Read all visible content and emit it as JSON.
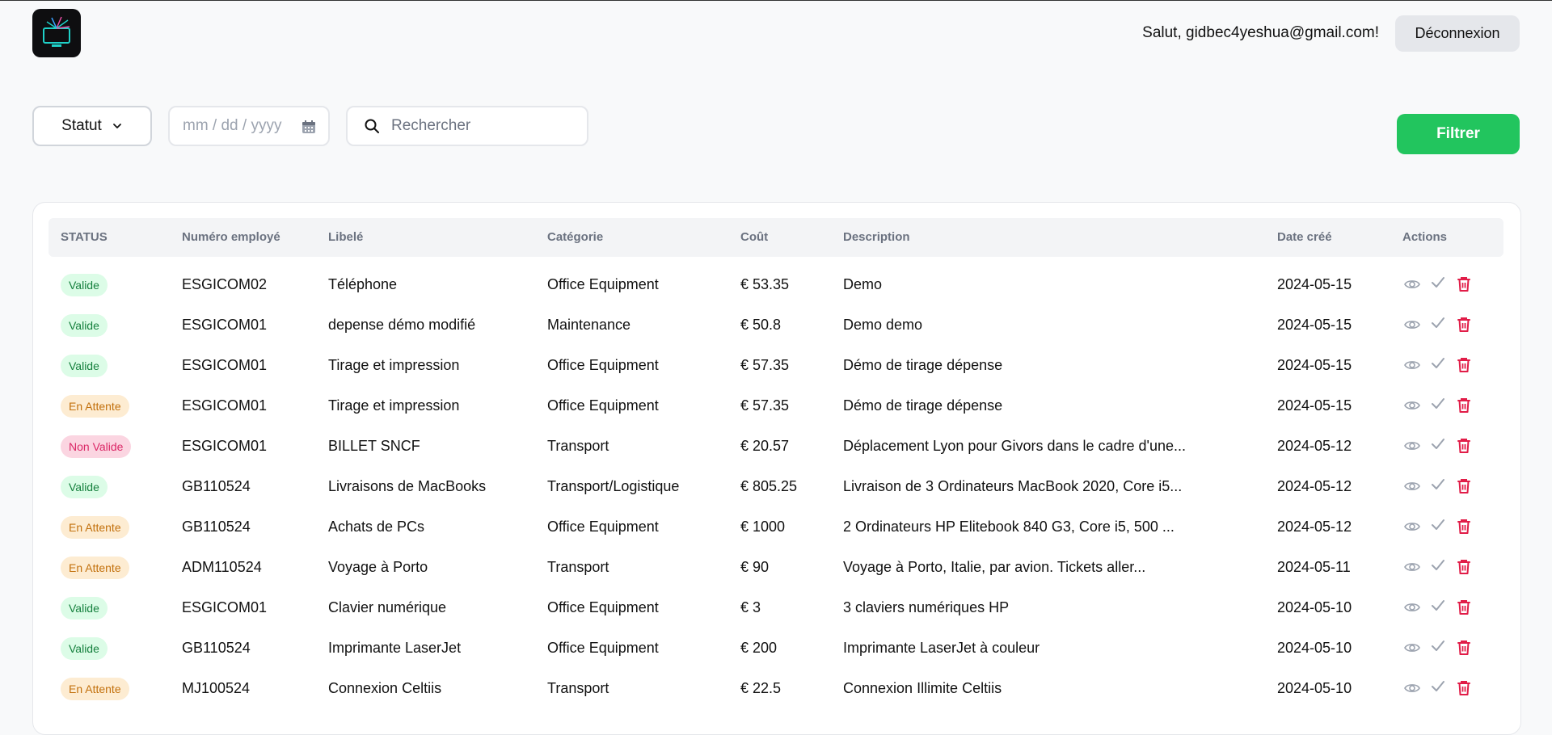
{
  "header": {
    "greeting": "Salut, gidbec4yeshua@gmail.com!",
    "logout_label": "Déconnexion"
  },
  "filters": {
    "status_label": "Statut",
    "date_placeholder": "mm / dd / yyyy",
    "search_placeholder": "Rechercher",
    "filter_label": "Filtrer"
  },
  "table": {
    "columns": [
      "STATUS",
      "Numéro employé",
      "Libelé",
      "Catégorie",
      "Coût",
      "Description",
      "Date créé",
      "Actions"
    ],
    "rows": [
      {
        "status": "Valide",
        "kind": "valide",
        "employee": "ESGICOM02",
        "label": "Téléphone",
        "category": "Office Equipment",
        "cost": "€ 53.35",
        "description": "Demo",
        "date": "2024-05-15"
      },
      {
        "status": "Valide",
        "kind": "valide",
        "employee": "ESGICOM01",
        "label": "depense démo modifié",
        "category": "Maintenance",
        "cost": "€ 50.8",
        "description": "Demo demo",
        "date": "2024-05-15"
      },
      {
        "status": "Valide",
        "kind": "valide",
        "employee": "ESGICOM01",
        "label": "Tirage et impression",
        "category": "Office Equipment",
        "cost": "€ 57.35",
        "description": "Démo de tirage dépense",
        "date": "2024-05-15"
      },
      {
        "status": "En Attente",
        "kind": "attente",
        "employee": "ESGICOM01",
        "label": "Tirage et impression",
        "category": "Office Equipment",
        "cost": "€ 57.35",
        "description": "Démo de tirage dépense",
        "date": "2024-05-15"
      },
      {
        "status": "Non Valide",
        "kind": "nonvalide",
        "employee": "ESGICOM01",
        "label": "BILLET SNCF",
        "category": "Transport",
        "cost": "€ 20.57",
        "description": "Déplacement Lyon pour Givors dans le cadre d'une...",
        "date": "2024-05-12"
      },
      {
        "status": "Valide",
        "kind": "valide",
        "employee": "GB110524",
        "label": "Livraisons de MacBooks",
        "category": "Transport/Logistique",
        "cost": "€ 805.25",
        "description": "Livraison de 3 Ordinateurs MacBook 2020, Core i5...",
        "date": "2024-05-12"
      },
      {
        "status": "En Attente",
        "kind": "attente",
        "employee": "GB110524",
        "label": "Achats de PCs",
        "category": "Office Equipment",
        "cost": "€ 1000",
        "description": "2 Ordinateurs HP Elitebook 840 G3, Core i5, 500 ...",
        "date": "2024-05-12"
      },
      {
        "status": "En Attente",
        "kind": "attente",
        "employee": "ADM110524",
        "label": "Voyage à Porto",
        "category": "Transport",
        "cost": "€ 90",
        "description": "Voyage à Porto, Italie, par avion. Tickets aller...",
        "date": "2024-05-11"
      },
      {
        "status": "Valide",
        "kind": "valide",
        "employee": "ESGICOM01",
        "label": "Clavier numérique",
        "category": "Office Equipment",
        "cost": "€ 3",
        "description": "3 claviers numériques HP",
        "date": "2024-05-10"
      },
      {
        "status": "Valide",
        "kind": "valide",
        "employee": "GB110524",
        "label": "Imprimante LaserJet",
        "category": "Office Equipment",
        "cost": "€ 200",
        "description": "Imprimante LaserJet à couleur",
        "date": "2024-05-10"
      },
      {
        "status": "En Attente",
        "kind": "attente",
        "employee": "MJ100524",
        "label": "Connexion Celtiis",
        "category": "Transport",
        "cost": "€ 22.5",
        "description": "Connexion Illimite Celtiis",
        "date": "2024-05-10"
      }
    ]
  },
  "icons": {
    "logo": "monitor-logo-icon",
    "chevron": "chevron-down-icon",
    "calendar": "calendar-icon",
    "search": "search-icon",
    "view": "eye-icon",
    "approve": "check-icon",
    "delete": "trash-icon"
  },
  "colors": {
    "primary_green": "#22c55e",
    "delete_red": "#e11d48",
    "valide_bg": "#dcfce7",
    "attente_bg": "#fdecd2",
    "nonvalide_bg": "#fbd5e1"
  }
}
